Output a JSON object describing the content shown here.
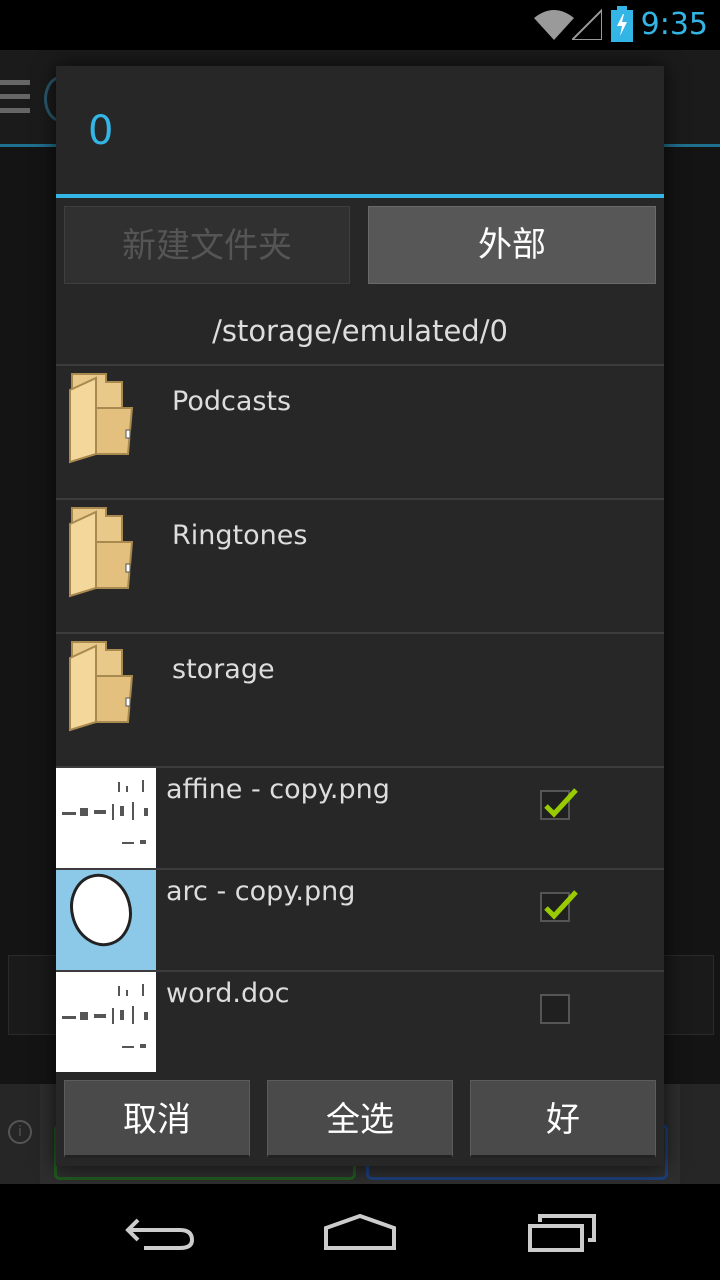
{
  "status_bar": {
    "time": "9:35"
  },
  "dialog": {
    "title": "0",
    "buttons": {
      "new_folder": "新建文件夹",
      "external": "外部"
    },
    "path": "/storage/emulated/0",
    "folders": [
      {
        "name": "Podcasts"
      },
      {
        "name": "Ringtones"
      },
      {
        "name": "storage"
      }
    ],
    "files": [
      {
        "name": "affine - copy.png",
        "checked": true
      },
      {
        "name": "arc - copy.png",
        "checked": true
      },
      {
        "name": "word.doc",
        "checked": false
      }
    ],
    "actions": {
      "cancel": "取消",
      "select_all": "全选",
      "ok": "好"
    }
  },
  "colors": {
    "accent": "#33b5e5",
    "check": "#99cc00"
  }
}
